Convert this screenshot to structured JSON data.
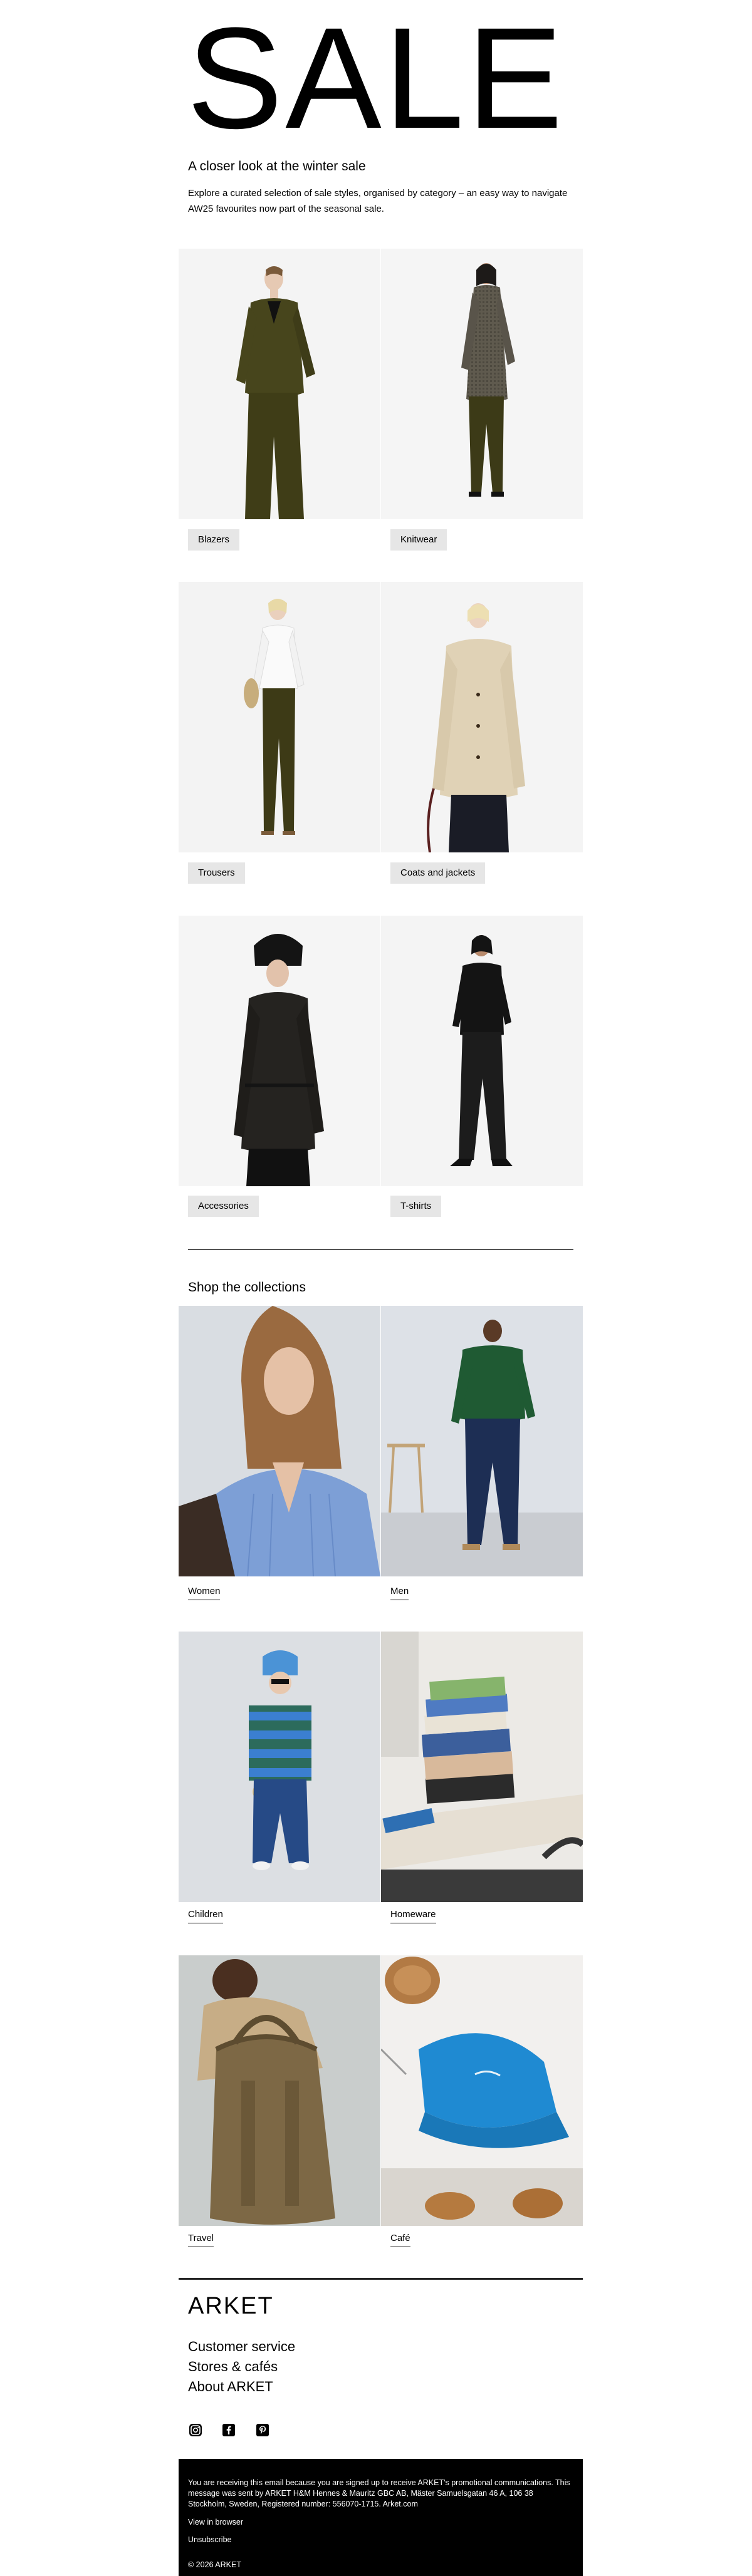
{
  "hero": {
    "title": "SALE"
  },
  "intro": {
    "title": "A closer look at the winter sale",
    "text": "Explore a curated selection of sale styles, organised by category – an easy way to navigate AW25 favourites now part of the seasonal sale."
  },
  "categories": [
    {
      "label": "Blazers"
    },
    {
      "label": "Knitwear"
    },
    {
      "label": "Trousers"
    },
    {
      "label": "Coats and jackets"
    },
    {
      "label": "Accessories"
    },
    {
      "label": "T-shirts"
    }
  ],
  "collections": {
    "title": "Shop the collections",
    "items": [
      {
        "label": "Women"
      },
      {
        "label": "Men"
      },
      {
        "label": "Children"
      },
      {
        "label": "Homeware"
      },
      {
        "label": "Travel"
      },
      {
        "label": "Café"
      }
    ]
  },
  "footer": {
    "brand": "ARKET",
    "links": [
      "Customer service",
      "Stores & cafés",
      "About ARKET"
    ],
    "social_icons": [
      "instagram-icon",
      "facebook-icon",
      "pinterest-icon"
    ],
    "legal": "You are receiving this email because you are signed up to receive ARKET's promotional communications. This message was sent by ARKET H&M Hennes & Mauritz GBC AB, Mäster Samuelsgatan 46 A, 106 38 Stockholm, Sweden, Registered number: 556070-1715. Arket.com",
    "view_in_browser": "View in browser",
    "unsubscribe": "Unsubscribe",
    "copyright": "© 2026 ARKET"
  },
  "colors": {
    "background": "#ffffff",
    "chip": "#e6e6e6",
    "footer_bg": "#000000",
    "footer_text": "#ffffff"
  }
}
